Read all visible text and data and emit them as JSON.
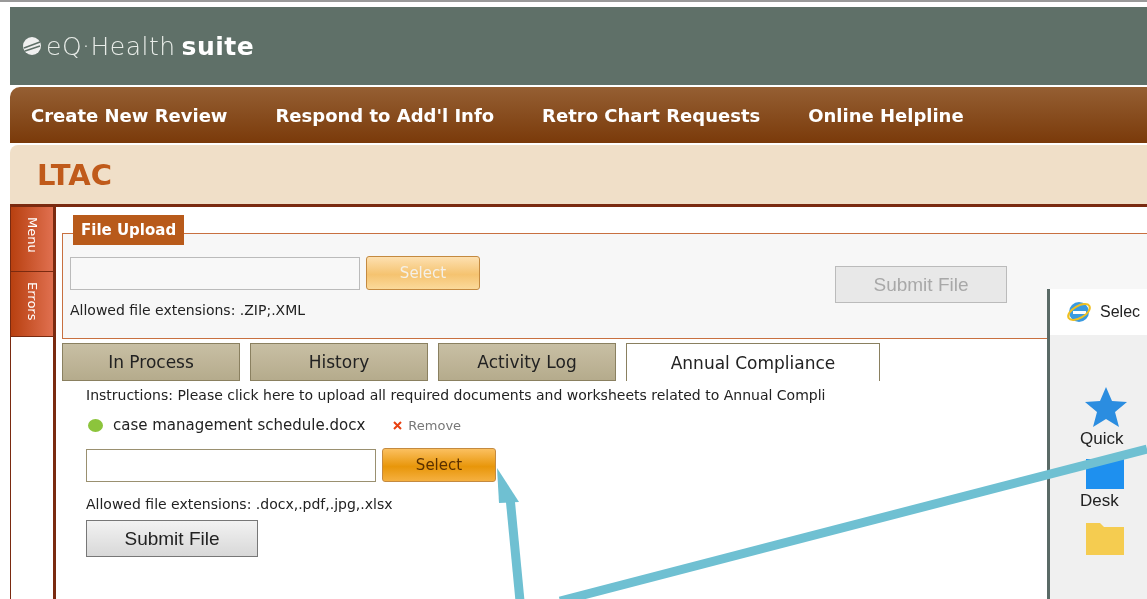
{
  "logo": {
    "brand": "eQ·Health",
    "suffix": "suite"
  },
  "nav": [
    "Create New Review",
    "Respond to Add'l Info",
    "Retro Chart Requests",
    "Online Helpline"
  ],
  "page_title": "LTAC",
  "side_tabs": [
    "Menu",
    "Errors"
  ],
  "file_upload": {
    "legend": "File Upload",
    "select": {
      "label": "Select",
      "disabled": true
    },
    "submit": {
      "label": "Submit File",
      "disabled": true
    },
    "allowed": "Allowed file extensions: .ZIP;.XML"
  },
  "tabs": [
    {
      "label": "In Process",
      "selected": false
    },
    {
      "label": "History",
      "selected": false
    },
    {
      "label": "Activity Log",
      "selected": false
    },
    {
      "label": "Annual Compliance",
      "selected": true
    }
  ],
  "compliance": {
    "instructions": "Instructions: Please click here to upload all required documents and worksheets related to Annual Compli",
    "files": [
      {
        "name": "case management schedule.docx",
        "remove": "Remove",
        "color": "#8cc43c"
      }
    ],
    "select": {
      "label": "Select",
      "disabled": false
    },
    "allowed": "Allowed file extensions: .docx,.pdf,.jpg,.xlsx",
    "submit": {
      "label": "Submit File",
      "disabled": false
    }
  },
  "dialog": {
    "title": "Selec",
    "places": [
      {
        "kind": "star",
        "label": "Quick"
      },
      {
        "kind": "desktop",
        "label": "Desk"
      },
      {
        "kind": "folder"
      }
    ]
  }
}
